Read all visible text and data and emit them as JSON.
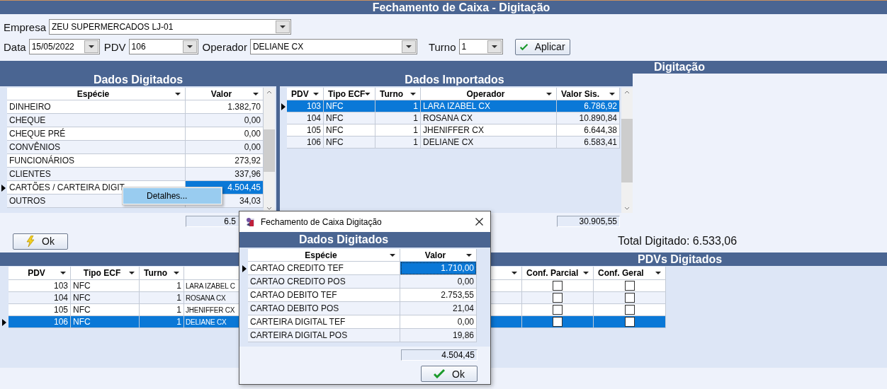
{
  "window": {
    "title": "Fechamento de Caixa - Digitação"
  },
  "filters": {
    "empresa": {
      "label": "Empresa",
      "value": "ZEU SUPERMERCADOS LJ-01"
    },
    "data": {
      "label": "Data",
      "value": "15/05/2022"
    },
    "pdv": {
      "label": "PDV",
      "value": "106"
    },
    "operador": {
      "label": "Operador",
      "value": "DELIANE CX"
    },
    "turno": {
      "label": "Turno",
      "value": "1"
    },
    "apply_button": "Aplicar"
  },
  "digitacao_header": "Digitação",
  "dados_digitados": {
    "title": "Dados Digitados",
    "columns": [
      "Espécie",
      "Valor"
    ],
    "rows": [
      {
        "especie": "DINHEIRO",
        "valor": "1.382,70",
        "selected": false
      },
      {
        "especie": "CHEQUE",
        "valor": "0,00",
        "selected": false
      },
      {
        "especie": "CHEQUE PRÉ",
        "valor": "0,00",
        "selected": false
      },
      {
        "especie": "CONVÊNIOS",
        "valor": "0,00",
        "selected": false
      },
      {
        "especie": "FUNCIONÁRIOS",
        "valor": "273,92",
        "selected": false
      },
      {
        "especie": "CLIENTES",
        "valor": "337,96",
        "selected": false
      },
      {
        "especie": "CARTÕES / CARTEIRA DIGIT",
        "valor": "4.504,45",
        "selected": true
      },
      {
        "especie": "OUTROS",
        "valor": "34,03",
        "selected": false
      }
    ],
    "total": "6.5"
  },
  "context_menu": {
    "items": [
      {
        "label": "Detalhes...",
        "selected": true
      }
    ]
  },
  "dados_importados": {
    "title": "Dados Importados",
    "columns": [
      "PDV",
      "Tipo ECF",
      "Turno",
      "Operador",
      "Valor Sis."
    ],
    "rows": [
      {
        "pdv": "103",
        "tipo_ecf": "NFC",
        "turno": "1",
        "operador": "LARA IZABEL CX",
        "valor_sis": "6.786,92",
        "selected": true
      },
      {
        "pdv": "104",
        "tipo_ecf": "NFC",
        "turno": "1",
        "operador": "ROSANA CX",
        "valor_sis": "10.890,84",
        "selected": false
      },
      {
        "pdv": "105",
        "tipo_ecf": "NFC",
        "turno": "1",
        "operador": "JHENIFFER CX",
        "valor_sis": "6.644,38",
        "selected": false
      },
      {
        "pdv": "106",
        "tipo_ecf": "NFC",
        "turno": "1",
        "operador": "DELIANE CX",
        "valor_sis": "6.583,41",
        "selected": false
      }
    ],
    "total": "30.905,55"
  },
  "ok_button": "Ok",
  "total_digitado": "Total Digitado: 6.533,06",
  "pdvs_digitados": {
    "title": "PDVs Digitados",
    "columns": [
      "PDV",
      "Tipo ECF",
      "Turno",
      "Conf. Parcial",
      "Conf. Geral"
    ],
    "rows": [
      {
        "pdv": "103",
        "tipo_ecf": "NFC",
        "turno": "1",
        "operador": "LARA IZABEL C",
        "conf_parcial": false,
        "conf_geral": false,
        "selected": false
      },
      {
        "pdv": "104",
        "tipo_ecf": "NFC",
        "turno": "1",
        "operador": "ROSANA CX",
        "conf_parcial": false,
        "conf_geral": false,
        "selected": false
      },
      {
        "pdv": "105",
        "tipo_ecf": "NFC",
        "turno": "1",
        "operador": "JHENIFFER CX",
        "conf_parcial": false,
        "conf_geral": false,
        "selected": false
      },
      {
        "pdv": "106",
        "tipo_ecf": "NFC",
        "turno": "1",
        "operador": "DELIANE CX",
        "conf_parcial": false,
        "conf_geral": false,
        "selected": true
      }
    ]
  },
  "dialog": {
    "title": "Fechamento de Caixa Digitação",
    "heading": "Dados Digitados",
    "columns": [
      "Espécie",
      "Valor"
    ],
    "rows": [
      {
        "especie": "CARTAO CREDITO TEF",
        "valor": "1.710,00",
        "selected": true
      },
      {
        "especie": "CARTAO CREDITO POS",
        "valor": "0,00",
        "selected": false
      },
      {
        "especie": "CARTAO DEBITO TEF",
        "valor": "2.753,55",
        "selected": false
      },
      {
        "especie": "CARTAO DEBITO POS",
        "valor": "21,04",
        "selected": false
      },
      {
        "especie": "CARTEIRA DIGITAL TEF",
        "valor": "0,00",
        "selected": false
      },
      {
        "especie": "CARTEIRA DIGITAL POS",
        "valor": "19,86",
        "selected": false
      }
    ],
    "total": "4.504,45",
    "ok_button": "Ok"
  }
}
